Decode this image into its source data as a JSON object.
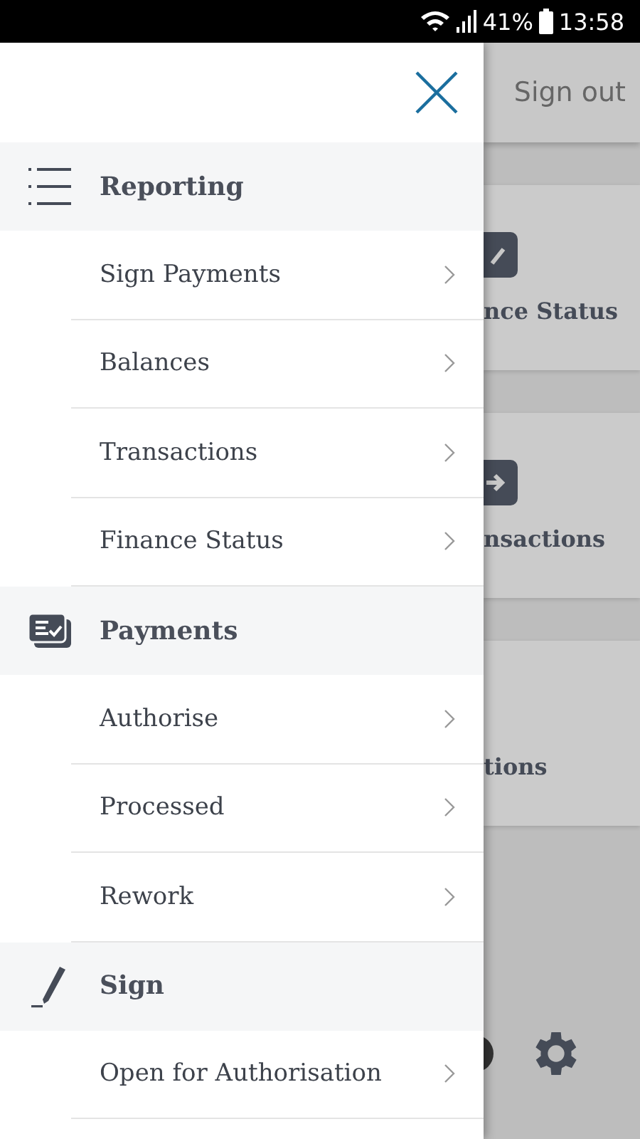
{
  "status_bar": {
    "battery": "41%",
    "time": "13:58"
  },
  "app_bar": {
    "action": "Sign out"
  },
  "cards": [
    {
      "label": "nce Status",
      "kind": "pencil"
    },
    {
      "label": "nsactions",
      "kind": "arrow"
    },
    {
      "label": "tions",
      "kind": "none"
    }
  ],
  "drawer": {
    "sections": [
      {
        "title": "Reporting",
        "kind": "list",
        "items": [
          "Sign Payments",
          "Balances",
          "Transactions",
          "Finance Status"
        ]
      },
      {
        "title": "Payments",
        "kind": "cards",
        "items": [
          "Authorise",
          "Processed",
          "Rework"
        ]
      },
      {
        "title": "Sign",
        "kind": "pen",
        "items": [
          "Open for Authorisation"
        ]
      }
    ]
  }
}
